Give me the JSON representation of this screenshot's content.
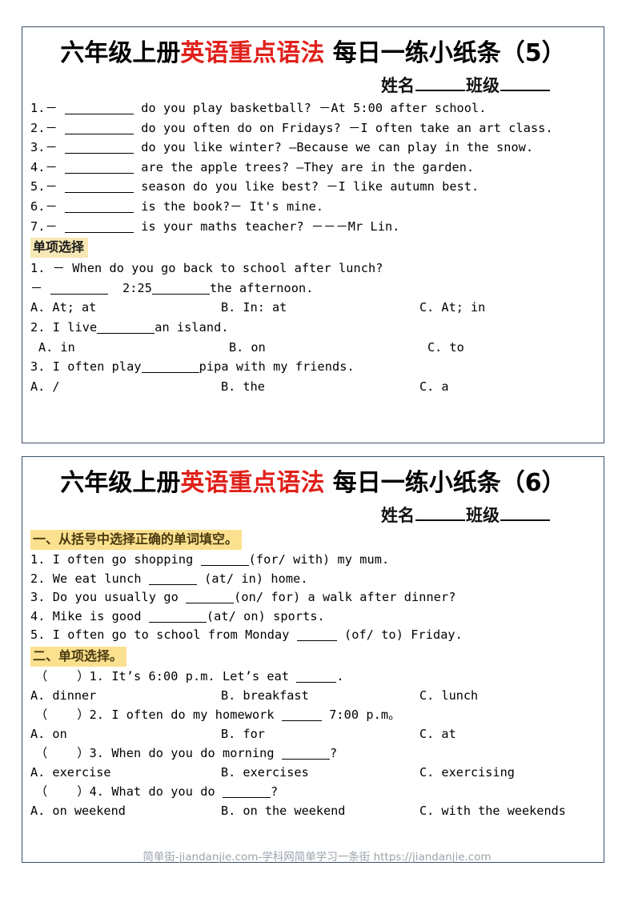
{
  "watermark": "简单街-jiandanjie.com-学科网简单学习一条街 https://jiandanjie.com",
  "colors": {
    "title_red": "#e0211b",
    "border": "#3c5068",
    "highlight_tan": "#f6e7b4",
    "highlight_yellow": "#fbe18f",
    "heading_text": "#4a3a10",
    "watermark": "#9aa3ac"
  },
  "sheet1": {
    "title_prefix": "六年级上册",
    "title_red": "英语重点语法",
    "title_suffix": " 每日一练小纸条（5）",
    "name_label": "姓名",
    "class_label": "班级",
    "fill_items": [
      {
        "num": "1.－",
        "tail": "do you play basketball? －At 5:00 after school."
      },
      {
        "num": "2.－",
        "tail": "do you often do on Fridays? －I often take an art class."
      },
      {
        "num": "3.－",
        "tail": "do you like winter? —Because we can play in the snow."
      },
      {
        "num": "4.－",
        "tail": "are the apple trees? —They are in the garden."
      },
      {
        "num": "5.－",
        "tail": "season do you like best? －I like autumn best."
      },
      {
        "num": "6.－",
        "tail": "is the book?－ It's mine."
      },
      {
        "num": "7.－",
        "tail": "is your maths teacher? －－－Mr Lin."
      }
    ],
    "mc_heading": "单项选择",
    "q1_line1": "1. － When do you go back to school after lunch?",
    "q1_line2_lead": "－",
    "q1_line2_mid": "2:25",
    "q1_line2_tail": "the afternoon.",
    "q1_options": [
      "A. At; at",
      "B. In: at",
      "C. At; in"
    ],
    "q2_lead": "2. I live",
    "q2_tail": "an island.",
    "q2_options": [
      "A. in",
      "B. on",
      "C. to"
    ],
    "q3_lead": "3. I often play",
    "q3_tail": "pipa with my friends.",
    "q3_options": [
      "A. /",
      "B. the",
      "C. a"
    ]
  },
  "sheet2": {
    "title_prefix": "六年级上册",
    "title_red": "英语重点语法",
    "title_suffix": " 每日一练小纸条（6）",
    "name_label": "姓名",
    "class_label": "班级",
    "section1_heading": "一、从括号中选择正确的单词填空。",
    "section1_items": [
      {
        "lead": "1. I often go shopping",
        "tail": "(for/ with) my mum."
      },
      {
        "lead": "2. We eat lunch",
        "tail": " (at/ in) home."
      },
      {
        "lead": "3. Do you usually go",
        "tail": "(on/ for) a walk after dinner?"
      },
      {
        "lead": "4. Mike is good",
        "tail": "(at/ on) sports."
      },
      {
        "lead": "5. I often go to school from Monday",
        "tail": " (of/ to) Friday."
      }
    ],
    "section2_heading": "二、单项选择。",
    "mc_items": [
      {
        "bracket_lead": "（",
        "bracket_tail": "）1.",
        "stem_lead": "It’s 6:00 p.m. Let’s eat",
        "stem_tail": ".",
        "options": [
          "A. dinner",
          "B. breakfast",
          "C. lunch"
        ]
      },
      {
        "bracket_lead": "（",
        "bracket_tail": "）2.",
        "stem_lead": "I often do my homework",
        "stem_tail": "7:00 p.m。",
        "options": [
          "A. on",
          "B. for",
          "C. at"
        ]
      },
      {
        "bracket_lead": "（",
        "bracket_tail": "）3.",
        "stem_lead": "When do you do morning",
        "stem_tail": "?",
        "options": [
          "A. exercise",
          "B. exercises",
          "C. exercising"
        ]
      },
      {
        "bracket_lead": "（",
        "bracket_tail": "）4.",
        "stem_lead": "What do you do",
        "stem_tail": "?",
        "options": [
          "A. on weekend",
          "B. on the weekend",
          "C. with the weekends"
        ]
      }
    ]
  }
}
